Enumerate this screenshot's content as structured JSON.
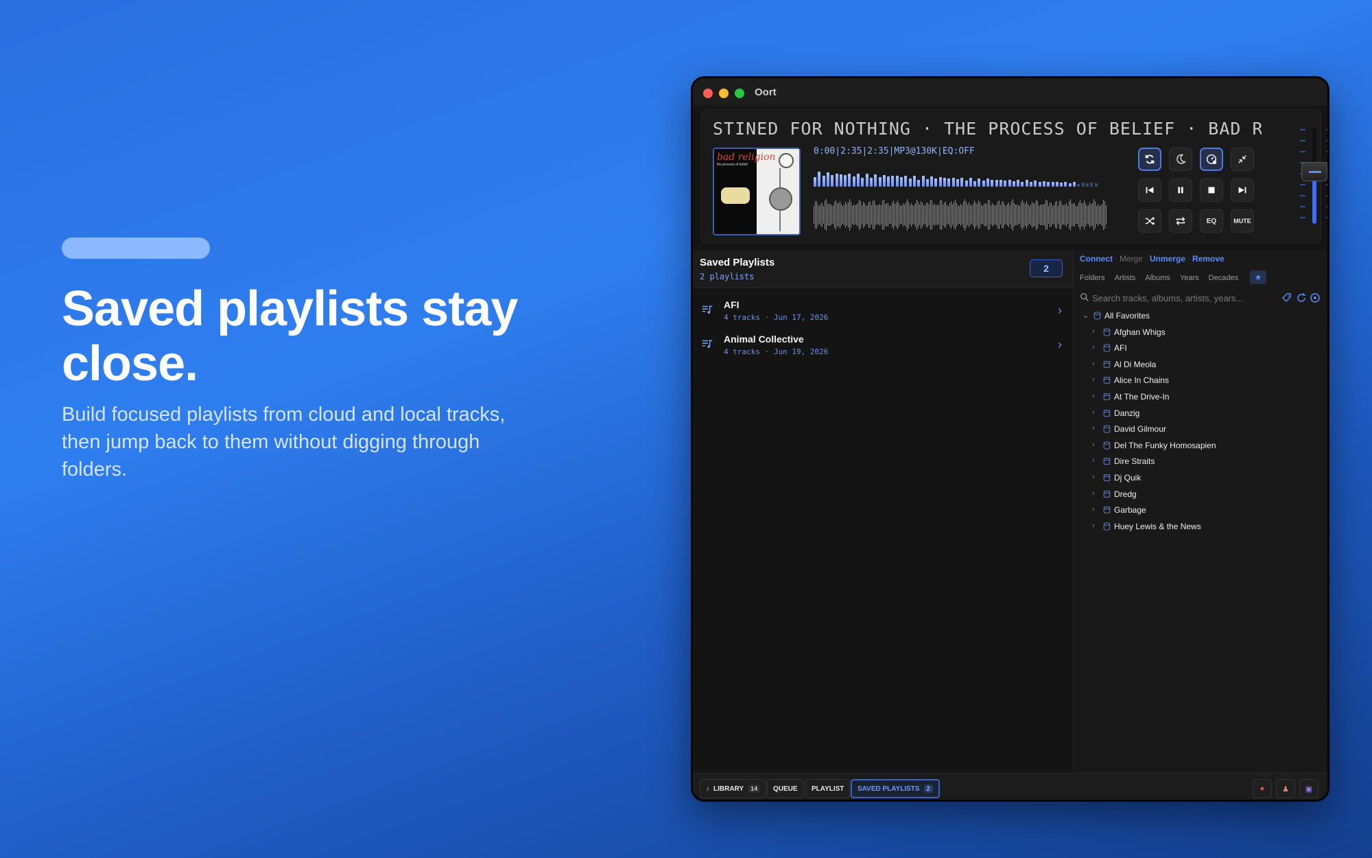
{
  "marketing": {
    "headline": "Saved playlists stay close.",
    "subline": "Build focused playlists from cloud and local tracks, then jump back to them without digging through folders."
  },
  "window": {
    "title": "Oort"
  },
  "player": {
    "marquee": "STINED FOR NOTHING  ·  THE PROCESS OF BELIEF  ·  BAD RE",
    "readout": "0:00|2:35|2:35|MP3@130K|EQ:OFF",
    "album_art": {
      "band_text": "bad religion",
      "sub_text": "the process of belief"
    },
    "controls": {
      "eq_label": "EQ",
      "mute_label": "MUTE"
    },
    "volume_percent": 50
  },
  "saved_playlists": {
    "title": "Saved Playlists",
    "subtitle": "2 playlists",
    "count": "2",
    "items": [
      {
        "name": "AFI",
        "meta": "4 tracks · Jun 17, 2026"
      },
      {
        "name": "Animal Collective",
        "meta": "4 tracks · Jun 19, 2026"
      }
    ]
  },
  "library": {
    "actions": {
      "connect": "Connect",
      "merge": "Merge",
      "unmerge": "Unmerge",
      "remove": "Remove"
    },
    "tabs": [
      "Folders",
      "Artists",
      "Albums",
      "Years",
      "Decades"
    ],
    "favorites_tab": "★",
    "search_placeholder": "Search tracks, albums, artists, years...",
    "root": "All Favorites",
    "entries": [
      {
        "name": "Afghan Whigs",
        "kind": "cloud"
      },
      {
        "name": "AFI",
        "kind": "cloud"
      },
      {
        "name": "Al Di Meola",
        "kind": "drive"
      },
      {
        "name": "Alice In Chains",
        "kind": "drive"
      },
      {
        "name": "At The Drive-In",
        "kind": "drive"
      },
      {
        "name": "Danzig",
        "kind": "drive"
      },
      {
        "name": "David Gilmour",
        "kind": "cloud"
      },
      {
        "name": "Del The Funky Homosapien",
        "kind": "cloud"
      },
      {
        "name": "Dire Straits",
        "kind": "drive"
      },
      {
        "name": "Dj Quik",
        "kind": "drive"
      },
      {
        "name": "Dredg",
        "kind": "drive"
      },
      {
        "name": "Garbage",
        "kind": "drive"
      },
      {
        "name": "Huey Lewis & the News",
        "kind": "cloud"
      }
    ]
  },
  "bottom_tabs": {
    "library": {
      "label": "LIBRARY",
      "count": "14"
    },
    "queue": {
      "label": "QUEUE"
    },
    "playlist": {
      "label": "PLAYLIST"
    },
    "saved": {
      "label": "SAVED PLAYLISTS",
      "count": "2"
    }
  },
  "colors": {
    "accent": "#5b8cff",
    "background_top": "#2f7ef0",
    "background_bottom": "#143f8e",
    "window_bg": "#141414"
  }
}
